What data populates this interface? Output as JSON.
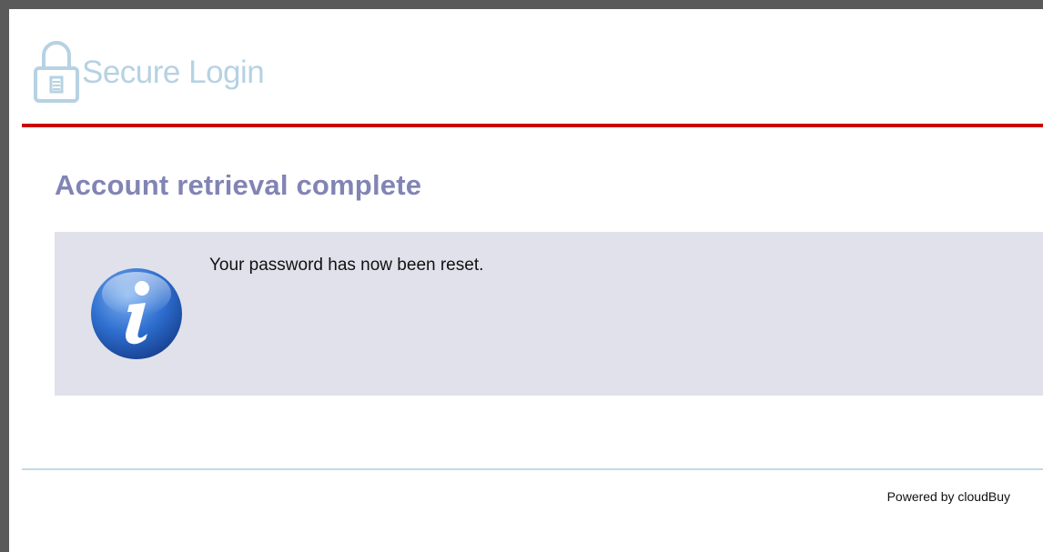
{
  "header": {
    "logo_text": "Secure Login",
    "logo_icon": "padlock-icon",
    "accent_color": "#cc0000"
  },
  "main": {
    "title": "Account retrieval complete",
    "info_panel": {
      "icon": "info-icon",
      "message": "Your password has now been reset."
    }
  },
  "footer": {
    "powered_by": "Powered by cloudBuy"
  },
  "colors": {
    "title": "#8184b4",
    "panel_background": "#e0e1ea",
    "logo": "#b6d2e3",
    "info_icon_blue": "#2a6fc9"
  }
}
